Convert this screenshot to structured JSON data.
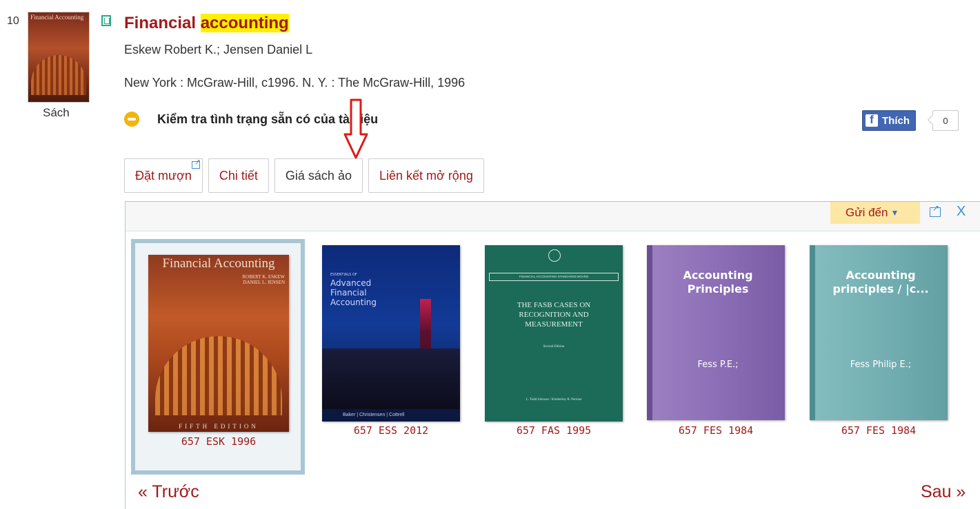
{
  "result": {
    "number": "10",
    "type_label": "Sách",
    "title_part1": "Financial ",
    "title_highlight": "accounting",
    "authors": "Eskew Robert K.; Jensen Daniel L",
    "publisher": "New York : McGraw-Hill, c1996. N. Y. : The McGraw-Hill, 1996",
    "availability": "Kiểm tra tình trạng sẵn có của tài liệu",
    "thumb_text": "Financial Accounting"
  },
  "facebook": {
    "like_label": "Thích",
    "count": "0"
  },
  "tabs": [
    {
      "label": "Đặt mượn"
    },
    {
      "label": "Chi tiết"
    },
    {
      "label": "Giá sách ảo"
    },
    {
      "label": "Liên kết mở rộng"
    }
  ],
  "panel": {
    "send_to": "Gửi đến",
    "close": "X"
  },
  "shelf": [
    {
      "callno": "657 ESK 1996",
      "title": "Financial Accounting",
      "authors": "ROBERT K. ESKEW\nDANIEL L. JENSEN",
      "edition": "FIFTH EDITION",
      "selected": true
    },
    {
      "callno": "657 ESS 2012",
      "kicker": "ESSENTIALS OF",
      "title": "Advanced Financial Accounting",
      "footer": "Baker | Christensen | Cottrell"
    },
    {
      "callno": "657 FAS 1995",
      "header": "FINANCIAL ACCOUNTING STANDARDS BOARD",
      "title": "THE FASB CASES ON RECOGNITION AND MEASUREMENT",
      "sub": "Second Edition",
      "authors": "L. Todd Johnson / Kimberley R. Petrone"
    },
    {
      "callno": "657 FES 1984",
      "title": "Accounting Principles",
      "author": "Fess P.E.;"
    },
    {
      "callno": "657 FES 1984",
      "title": "Accounting principles / |c...",
      "author": "Fess Philip E.;"
    }
  ],
  "nav": {
    "prev": "« Trước",
    "next": "Sau »"
  },
  "colors": {
    "accent": "#a01a1a",
    "highlight": "#ffef00",
    "panel_border": "#9fcfd4"
  }
}
